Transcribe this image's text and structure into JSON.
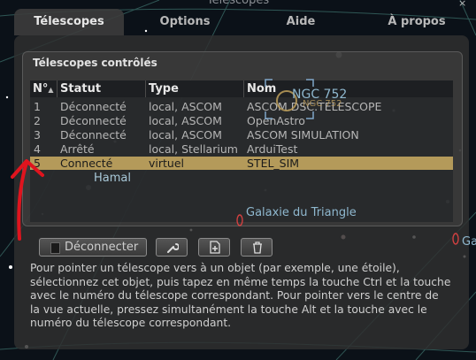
{
  "window": {
    "title": "Télescopes",
    "close_label": "×"
  },
  "tabs": [
    {
      "label": "Télescopes",
      "active": true
    },
    {
      "label": "Options",
      "active": false
    },
    {
      "label": "Aide",
      "active": false
    },
    {
      "label": "À propos",
      "active": false
    }
  ],
  "group_title": "Télescopes contrôlés",
  "table": {
    "headers": [
      "N°",
      "Statut",
      "Type",
      "Nom"
    ],
    "rows": [
      {
        "num": "1",
        "status": "Déconnecté",
        "type": "local, ASCOM",
        "name": "ASCOM.DSC.TELESCOPE"
      },
      {
        "num": "2",
        "status": "Déconnecté",
        "type": "local, ASCOM",
        "name": "OpenAstro"
      },
      {
        "num": "3",
        "status": "Déconnecté",
        "type": "local, ASCOM",
        "name": "ASCOM SIMULATION"
      },
      {
        "num": "4",
        "status": "Arrêté",
        "type": "local, Stellarium",
        "name": "ArduiTest"
      },
      {
        "num": "5",
        "status": "Connecté",
        "type": "virtuel",
        "name": "STEL_SIM",
        "selected": true
      }
    ]
  },
  "buttons": {
    "disconnect_label": "Déconnecter",
    "configure_icon": "wrench-icon",
    "add_icon": "add-document-icon",
    "remove_icon": "trash-icon"
  },
  "help_text": "Pour pointer un télescope vers à un objet (par exemple, une étoile), sélectionnez cet objet, puis tapez en même temps la touche Ctrl et la touche avec le numéro du télescope correspondant. Pour pointer vers le centre de la vue actuelle, pressez simultanément la touche Alt et la touche avec le numéro du télescope correspondant.",
  "sky_labels": {
    "ngc": "NGC 752",
    "ngc_sub": "NGC 752",
    "hamal": "Hamal",
    "triangle": "Galaxie du Triangle",
    "edge": "Ga"
  },
  "colors": {
    "selection": "#b49a5a",
    "annotation_arrow": "#e0141e",
    "sky_label": "#8fb8cf",
    "marker": "#c8a050"
  }
}
